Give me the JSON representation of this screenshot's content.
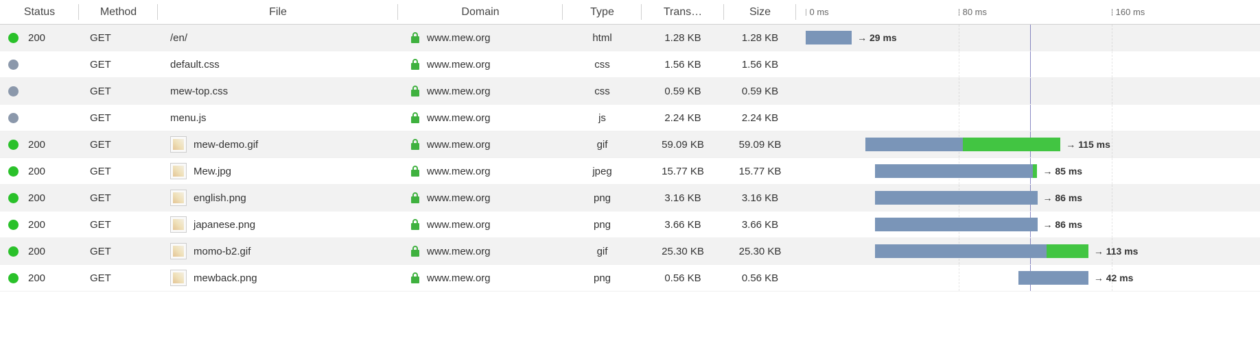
{
  "columns": {
    "status": "Status",
    "method": "Method",
    "file": "File",
    "domain": "Domain",
    "type": "Type",
    "trans": "Trans…",
    "size": "Size"
  },
  "timeline": {
    "ticks": [
      {
        "label": "0 ms",
        "pos": 2
      },
      {
        "label": "80 ms",
        "pos": 35
      },
      {
        "label": "160 ms",
        "pos": 68
      }
    ],
    "marker_pos": 50.5
  },
  "rows": [
    {
      "status_color": "green",
      "status": "200",
      "method": "GET",
      "file": "/en/",
      "has_thumb": false,
      "domain": "www.mew.org",
      "type": "html",
      "trans": "1.28 KB",
      "size": "1.28 KB",
      "bar": {
        "start": 2,
        "wait": 10,
        "recv": 0,
        "label": "29 ms"
      }
    },
    {
      "status_color": "gray",
      "status": "",
      "method": "GET",
      "file": "default.css",
      "has_thumb": false,
      "domain": "www.mew.org",
      "type": "css",
      "trans": "1.56 KB",
      "size": "1.56 KB",
      "bar": null
    },
    {
      "status_color": "gray",
      "status": "",
      "method": "GET",
      "file": "mew-top.css",
      "has_thumb": false,
      "domain": "www.mew.org",
      "type": "css",
      "trans": "0.59 KB",
      "size": "0.59 KB",
      "bar": null
    },
    {
      "status_color": "gray",
      "status": "",
      "method": "GET",
      "file": "menu.js",
      "has_thumb": false,
      "domain": "www.mew.org",
      "type": "js",
      "trans": "2.24 KB",
      "size": "2.24 KB",
      "bar": null
    },
    {
      "status_color": "green",
      "status": "200",
      "method": "GET",
      "file": "mew-demo.gif",
      "has_thumb": true,
      "domain": "www.mew.org",
      "type": "gif",
      "trans": "59.09 KB",
      "size": "59.09 KB",
      "bar": {
        "start": 15,
        "wait": 21,
        "recv": 21,
        "label": "115 ms"
      }
    },
    {
      "status_color": "green",
      "status": "200",
      "method": "GET",
      "file": "Mew.jpg",
      "has_thumb": true,
      "domain": "www.mew.org",
      "type": "jpeg",
      "trans": "15.77 KB",
      "size": "15.77 KB",
      "bar": {
        "start": 17,
        "wait": 34,
        "recv": 1,
        "label": "85 ms"
      }
    },
    {
      "status_color": "green",
      "status": "200",
      "method": "GET",
      "file": "english.png",
      "has_thumb": true,
      "domain": "www.mew.org",
      "type": "png",
      "trans": "3.16 KB",
      "size": "3.16 KB",
      "bar": {
        "start": 17,
        "wait": 35,
        "recv": 0,
        "label": "86 ms"
      }
    },
    {
      "status_color": "green",
      "status": "200",
      "method": "GET",
      "file": "japanese.png",
      "has_thumb": true,
      "domain": "www.mew.org",
      "type": "png",
      "trans": "3.66 KB",
      "size": "3.66 KB",
      "bar": {
        "start": 17,
        "wait": 35,
        "recv": 0,
        "label": "86 ms"
      }
    },
    {
      "status_color": "green",
      "status": "200",
      "method": "GET",
      "file": "momo-b2.gif",
      "has_thumb": true,
      "domain": "www.mew.org",
      "type": "gif",
      "trans": "25.30 KB",
      "size": "25.30 KB",
      "bar": {
        "start": 17,
        "wait": 37,
        "recv": 9,
        "label": "113 ms"
      }
    },
    {
      "status_color": "green",
      "status": "200",
      "method": "GET",
      "file": "mewback.png",
      "has_thumb": true,
      "domain": "www.mew.org",
      "type": "png",
      "trans": "0.56 KB",
      "size": "0.56 KB",
      "bar": {
        "start": 48,
        "wait": 15,
        "recv": 0,
        "label": "42 ms"
      }
    }
  ]
}
